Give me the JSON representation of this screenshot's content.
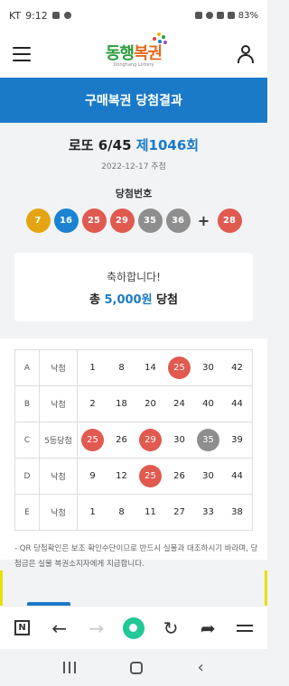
{
  "status": {
    "carrier": "KT",
    "time": "9:12",
    "battery": "83%"
  },
  "app": {
    "logo_main": "동행",
    "logo_accent": "복권",
    "logo_sub": "Donghang Lottery"
  },
  "title": "구매복권 당첨결과",
  "draw": {
    "game": "로또 6/45",
    "round": "제1046회",
    "date": "2022-12-17 추첨"
  },
  "winning": {
    "label": "당첨번호",
    "plus": "+",
    "numbers": [
      {
        "n": "7",
        "color": "#e5a513"
      },
      {
        "n": "16",
        "color": "#1b83d1"
      },
      {
        "n": "25",
        "color": "#e05a4f"
      },
      {
        "n": "29",
        "color": "#e05a4f"
      },
      {
        "n": "35",
        "color": "#8e8e8e"
      },
      {
        "n": "36",
        "color": "#8e8e8e"
      }
    ],
    "bonus": {
      "n": "28",
      "color": "#e05a4f"
    }
  },
  "congrats": {
    "line1": "축하합니다!",
    "prefix": "총 ",
    "amount": "5,000원",
    "suffix": " 당첨"
  },
  "games": [
    {
      "id": "A",
      "result": "낙첨",
      "numbers": [
        {
          "n": "1"
        },
        {
          "n": "8"
        },
        {
          "n": "14"
        },
        {
          "n": "25",
          "hit": "#e05a4f"
        },
        {
          "n": "30"
        },
        {
          "n": "42"
        }
      ]
    },
    {
      "id": "B",
      "result": "낙첨",
      "numbers": [
        {
          "n": "2"
        },
        {
          "n": "18"
        },
        {
          "n": "20"
        },
        {
          "n": "24"
        },
        {
          "n": "40"
        },
        {
          "n": "44"
        }
      ]
    },
    {
      "id": "C",
      "result": "5등당첨",
      "numbers": [
        {
          "n": "25",
          "hit": "#e05a4f"
        },
        {
          "n": "26"
        },
        {
          "n": "29",
          "hit": "#e05a4f"
        },
        {
          "n": "30"
        },
        {
          "n": "35",
          "hit": "#8e8e8e"
        },
        {
          "n": "39"
        }
      ]
    },
    {
      "id": "D",
      "result": "낙첨",
      "numbers": [
        {
          "n": "9"
        },
        {
          "n": "12"
        },
        {
          "n": "25",
          "hit": "#e05a4f"
        },
        {
          "n": "26"
        },
        {
          "n": "30"
        },
        {
          "n": "44"
        }
      ]
    },
    {
      "id": "E",
      "result": "낙첨",
      "numbers": [
        {
          "n": "1"
        },
        {
          "n": "8"
        },
        {
          "n": "11"
        },
        {
          "n": "27"
        },
        {
          "n": "33"
        },
        {
          "n": "38"
        }
      ]
    }
  ],
  "notice": "- QR 당첨확인은 보조 확인수단이므로 반드시 실물과 대조하시기 바라며, 당첨금은 실물 복권소지자에게 지급합니다.",
  "browser": {
    "n_label": "N"
  },
  "colors": {
    "brand_blue": "#1b7ac8",
    "logo_green": "#2a9d3d",
    "logo_orange": "#e06a1a",
    "toolbar_green": "#20c997"
  }
}
